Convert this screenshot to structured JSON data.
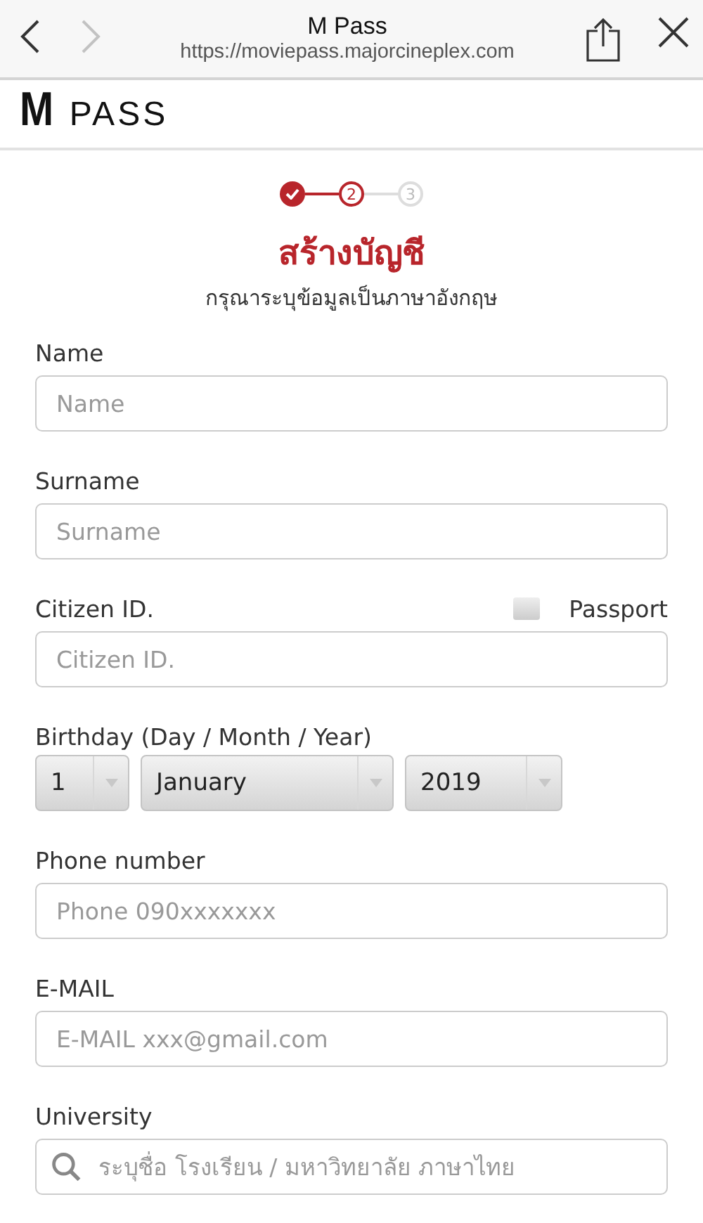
{
  "browser": {
    "title": "M Pass",
    "url": "https://moviepass.majorcineplex.com",
    "back_disabled": false,
    "forward_disabled": true
  },
  "logo": {
    "mark": "M",
    "text": "PASS"
  },
  "steps": [
    {
      "kind": "done"
    },
    {
      "kind": "current",
      "label": "2"
    },
    {
      "kind": "upcoming",
      "label": "3"
    }
  ],
  "heading": "สร้างบัญชี",
  "subheading": "กรุณาระบุข้อมูลเป็นภาษาอังกฤษ",
  "fields": [
    {
      "kind": "text",
      "label": "Name",
      "placeholder": "Name"
    },
    {
      "kind": "text",
      "label": "Surname",
      "placeholder": "Surname"
    },
    {
      "kind": "text",
      "label": "Citizen ID.",
      "placeholder": "Citizen ID.",
      "option": {
        "label": "Passport",
        "checked": false
      }
    },
    {
      "kind": "date",
      "label": "Birthday (Day / Month / Year)",
      "selects": [
        "1",
        "January",
        "2019"
      ]
    },
    {
      "kind": "text",
      "label": "Phone number",
      "placeholder": "Phone 090xxxxxxx"
    },
    {
      "kind": "text",
      "label": "E-MAIL",
      "placeholder": "E-MAIL xxx@gmail.com"
    },
    {
      "kind": "search",
      "label": "University",
      "placeholder": "ระบุชื่อ โรงเรียน / มหาวิทยาลัย ภาษาไทย"
    }
  ]
}
